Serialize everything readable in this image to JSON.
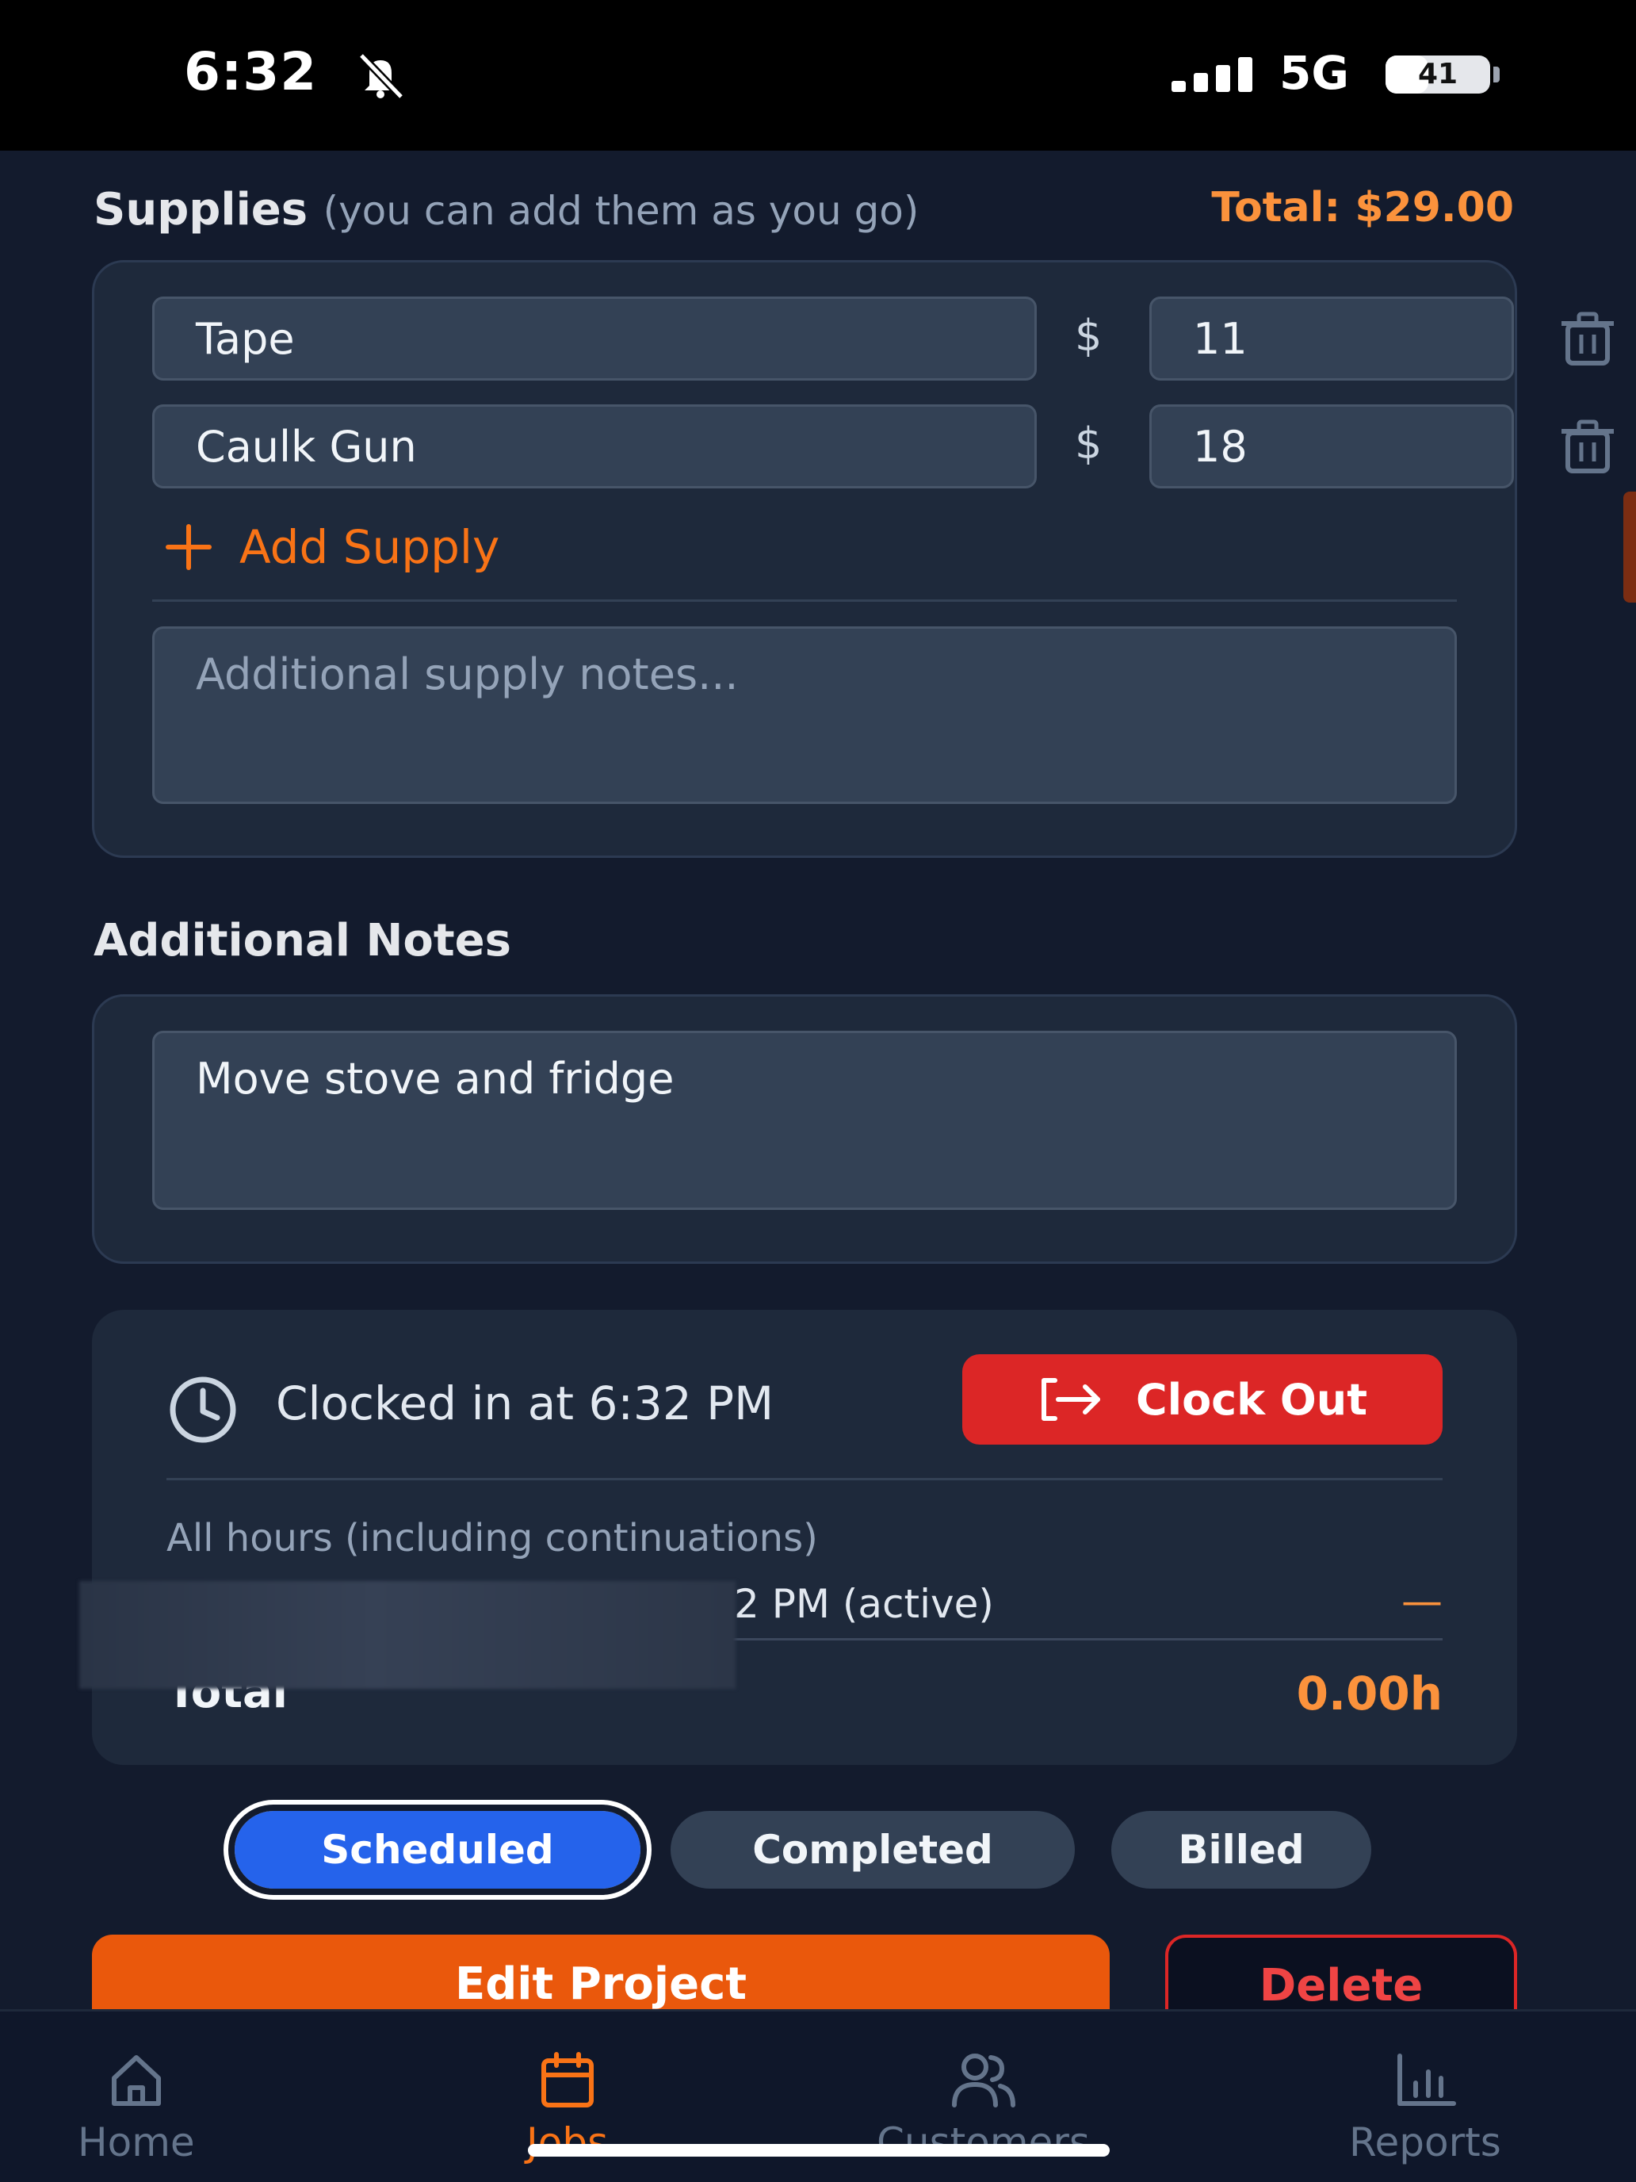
{
  "status_bar": {
    "time": "6:32",
    "network": "5G",
    "battery": "41",
    "battery_level": 0.41
  },
  "supplies": {
    "title": "Supplies",
    "hint": "(you can add them as you go)",
    "total": "Total: $29.00",
    "currency_symbol": "$",
    "items": [
      {
        "name": "Tape",
        "price": "11"
      },
      {
        "name": "Caulk Gun",
        "price": "18"
      }
    ],
    "add_label": "Add Supply",
    "notes_placeholder": "Additional supply notes..."
  },
  "additional_notes": {
    "title": "Additional Notes",
    "value": "Move stove and fridge"
  },
  "clock": {
    "status": "Clocked in at 6:32 PM",
    "clock_out_label": "Clock Out",
    "hours_title": "All hours (including continuations)",
    "entry_text": "2 PM (active)",
    "entry_value": "—",
    "total_label": "Total",
    "total_value": "0.00h"
  },
  "status_options": {
    "selected": "Scheduled",
    "options": [
      "Scheduled",
      "Completed",
      "Billed"
    ]
  },
  "actions": {
    "edit": "Edit Project",
    "delete": "Delete"
  },
  "nav": {
    "items": [
      {
        "label": "Home",
        "icon": "home-icon"
      },
      {
        "label": "Jobs",
        "icon": "calendar-icon"
      },
      {
        "label": "Customers",
        "icon": "users-icon"
      },
      {
        "label": "Reports",
        "icon": "bar-chart-icon"
      }
    ],
    "active": "Jobs"
  },
  "colors": {
    "background": "#131b2d",
    "card": "#1e293b",
    "accent_orange": "#f97316",
    "danger_red": "#dc2626",
    "selected_blue": "#2563eb"
  }
}
